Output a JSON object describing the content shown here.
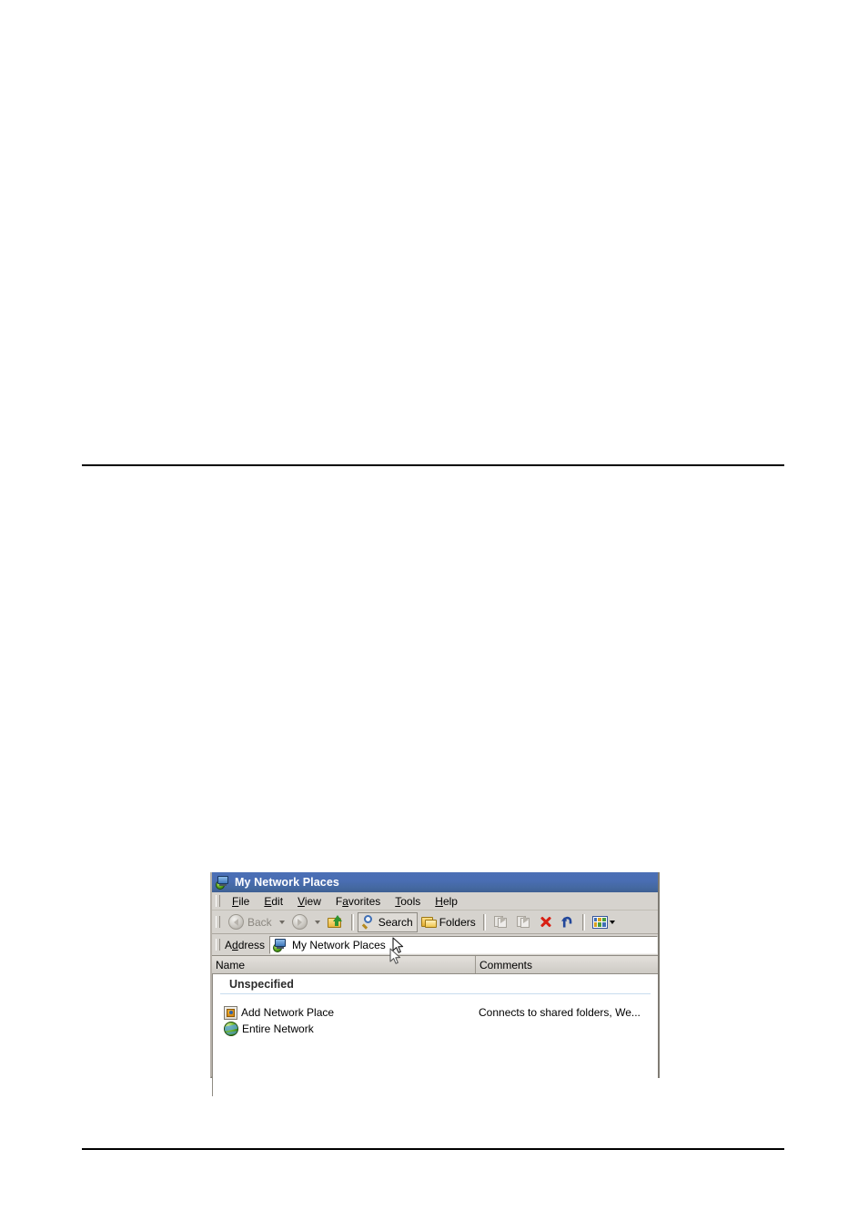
{
  "document": {
    "rules": [
      "top-rule",
      "bottom-rule"
    ]
  },
  "window": {
    "title": "My Network Places",
    "title_icon": "network-computer-icon",
    "menu": [
      {
        "label": "File",
        "accel": "F"
      },
      {
        "label": "Edit",
        "accel": "E"
      },
      {
        "label": "View",
        "accel": "V"
      },
      {
        "label": "Favorites",
        "accel": "a"
      },
      {
        "label": "Tools",
        "accel": "T"
      },
      {
        "label": "Help",
        "accel": "H"
      }
    ],
    "toolbar": {
      "back_label": "Back",
      "back_icon": "back-arrow-icon",
      "back_dropdown_icon": "chevron-down-icon",
      "forward_icon": "forward-arrow-icon",
      "forward_dropdown_icon": "chevron-down-icon",
      "up_icon": "up-folder-icon",
      "search_label": "Search",
      "search_icon": "magnifier-icon",
      "folders_label": "Folders",
      "folders_icon": "folders-icon",
      "move_to_icon": "move-to-icon",
      "copy_to_icon": "copy-to-icon",
      "delete_icon": "delete-x-icon",
      "undo_icon": "undo-arrow-icon",
      "views_icon": "views-grid-icon",
      "views_dropdown_icon": "chevron-down-icon"
    },
    "address": {
      "label": "Address",
      "value": "My Network Places",
      "icon": "network-computer-icon"
    },
    "list": {
      "columns": [
        "Name",
        "Comments"
      ],
      "group_header": "Unspecified",
      "rows": [
        {
          "icon": "add-network-place-icon",
          "name": "Add Network Place",
          "comment": "Connects to shared folders, We..."
        },
        {
          "icon": "globe-icon",
          "name": "Entire Network",
          "comment": ""
        }
      ]
    }
  },
  "cursors": {
    "toolbar_pointer": "arrow-cursor",
    "address_pointer": "arrow-cursor"
  },
  "colors": {
    "title_bar": "#4a6eb4",
    "chrome": "#d6d3ce",
    "delete_red": "#d81f13",
    "undo_blue": "#22479a",
    "group_rule": "#c8dcee"
  }
}
